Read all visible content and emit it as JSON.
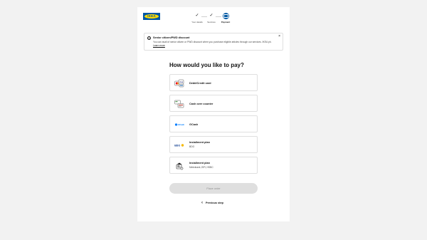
{
  "header": {
    "logo_text": "IKEA",
    "steps": [
      {
        "label": "Your details",
        "state": "done"
      },
      {
        "label": "Services",
        "state": "done"
      },
      {
        "label": "Payment",
        "state": "active"
      }
    ]
  },
  "banner": {
    "title": "Senior citizen/PWD discount",
    "text": "You can avail of senior citizen or PWD discount when you purchase eligible articles through our services. IKEA ph.",
    "link": "Learn more",
    "close_icon": "close-icon"
  },
  "heading": "How would you like to pay?",
  "payment_options": [
    {
      "name": "Debit/Credit card",
      "sub": "",
      "icon": "card-icon"
    },
    {
      "name": "Cash over counter",
      "sub": "",
      "icon": "cash-counter-icon"
    },
    {
      "name": "GCash",
      "sub": "",
      "icon": "gcash-icon"
    },
    {
      "name": "Installment plan",
      "sub": "BDO",
      "icon": "bdo-icon"
    },
    {
      "name": "Installment plan",
      "sub": "Metrobank, BPI, HSBC",
      "icon": "installment-icon"
    }
  ],
  "actions": {
    "place_order": "Place order",
    "previous": "Previous step"
  },
  "colors": {
    "brand_blue": "#0058a3",
    "brand_yellow": "#ffdb00",
    "background": "#f2f2f2",
    "disabled_button": "#dfdfdf"
  }
}
